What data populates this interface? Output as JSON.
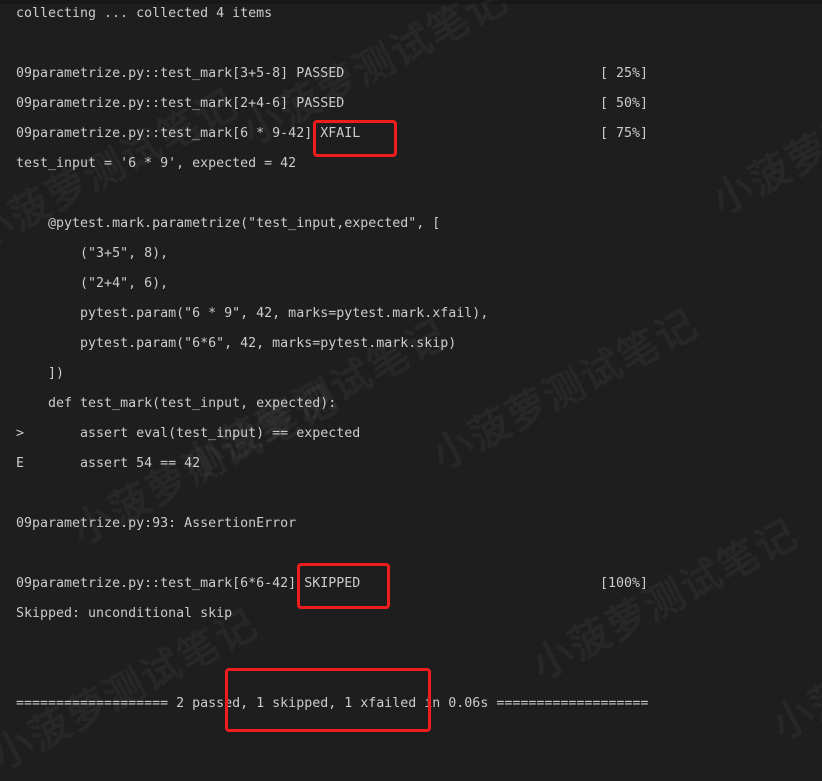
{
  "terminal": {
    "collecting": "collecting ... collected 4 items",
    "results": [
      {
        "line": "09parametrize.py::test_mark[3+5-8] PASSED",
        "test_id": "09parametrize.py::test_mark[3+5-8]",
        "status": "PASSED",
        "progress": "[ 25%]"
      },
      {
        "line": "09parametrize.py::test_mark[2+4-6] PASSED",
        "test_id": "09parametrize.py::test_mark[2+4-6]",
        "status": "PASSED",
        "progress": "[ 50%]"
      },
      {
        "line": "09parametrize.py::test_mark[6 * 9-42] XFAIL",
        "test_id": "09parametrize.py::test_mark[6 * 9-42]",
        "status": "XFAIL",
        "progress": "[ 75%]"
      }
    ],
    "xfail_detail": {
      "params_line": "test_input = '6 * 9', expected = 42",
      "code": [
        "    @pytest.mark.parametrize(\"test_input,expected\", [",
        "        (\"3+5\", 8),",
        "        (\"2+4\", 6),",
        "        pytest.param(\"6 * 9\", 42, marks=pytest.mark.xfail),",
        "        pytest.param(\"6*6\", 42, marks=pytest.mark.skip)",
        "    ])",
        "    def test_mark(test_input, expected):",
        ">       assert eval(test_input) == expected",
        "E       assert 54 == 42"
      ],
      "error_location": "09parametrize.py:93: AssertionError"
    },
    "skipped_result": {
      "line": "09parametrize.py::test_mark[6*6-42] SKIPPED",
      "test_id": "09parametrize.py::test_mark[6*6-42]",
      "status": "SKIPPED",
      "progress": "[100%]"
    },
    "skip_reason": "Skipped: unconditional skip",
    "summary": "=================== 2 passed, 1 skipped, 1 xfailed in 0.06s ===================",
    "watermark_text": "小菠萝测试笔记"
  },
  "colors": {
    "background": "#1e1e1e",
    "text": "#cccccc",
    "highlight_box": "#f01d1d"
  }
}
